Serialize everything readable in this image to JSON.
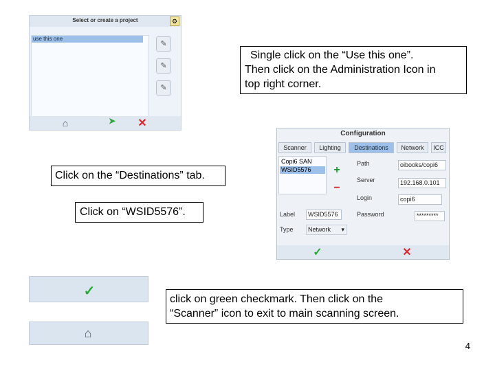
{
  "project_screen": {
    "title": "Select or create a project",
    "selected_project": "use this one",
    "corner_icon": "tools-icon",
    "bottom_icons": [
      "scanner-icon",
      "cursor-icon",
      "close-icon"
    ]
  },
  "callouts": {
    "c1_line1": "Single click on the “Use this one”.",
    "c1_line2": "Then click on the Administration Icon in",
    "c1_line3": "top right corner.",
    "c2": "Click on the “Destinations” tab.",
    "c3": "Click on “WSID5576”.",
    "c4_line1": "click on green checkmark. Then click on the",
    "c4_line2": "“Scanner” icon to exit to main scanning screen."
  },
  "config_screen": {
    "title": "Configuration",
    "tabs": [
      {
        "label": "Scanner"
      },
      {
        "label": "Lighting"
      },
      {
        "label": "Destinations"
      },
      {
        "label": "Network"
      },
      {
        "label": "ICC"
      }
    ],
    "active_tab": "Destinations",
    "destinations": [
      "Copi6 SAN",
      "WSID5576"
    ],
    "selected_destination": "WSID5576",
    "fields": {
      "path_label": "Path",
      "path_value": "oibooks/copi6",
      "server_label": "Server",
      "server_value": "192.168.0.101",
      "login_label": "Login",
      "login_value": "copi6",
      "password_label": "Password",
      "password_value": "*********",
      "label_label": "Label",
      "label_value": "WSID5576",
      "type_label": "Type",
      "type_value": "Network"
    }
  },
  "page_number": "4"
}
